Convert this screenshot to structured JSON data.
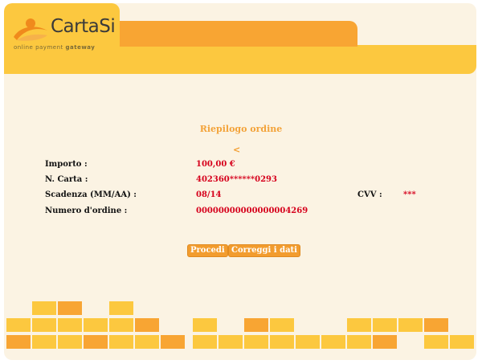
{
  "brand": {
    "name": "CartaSi",
    "tagline_prefix": "online payment ",
    "tagline_bold": "gateway"
  },
  "summary": {
    "title": "Riepilogo ordine",
    "back_link": "<",
    "rows": {
      "importo_label": "Importo :",
      "importo_value": "100,00 €",
      "carta_label": "N. Carta :",
      "carta_value": "402360******0293",
      "scadenza_label": "Scadenza (MM/AA) :",
      "scadenza_value": "08/14",
      "cvv_label": "CVV :",
      "cvv_value": "***",
      "ordine_label": "Numero d'ordine :",
      "ordine_value": "00000000000000004269"
    }
  },
  "actions": {
    "proceed_label": "Procedi",
    "edit_label": "Correggi i dati"
  },
  "colors": {
    "background": "#fbf3e3",
    "yellow": "#fcc83f",
    "orange": "#f8a533",
    "dark_orange": "#f29c2e",
    "value_red": "#d6001c"
  }
}
